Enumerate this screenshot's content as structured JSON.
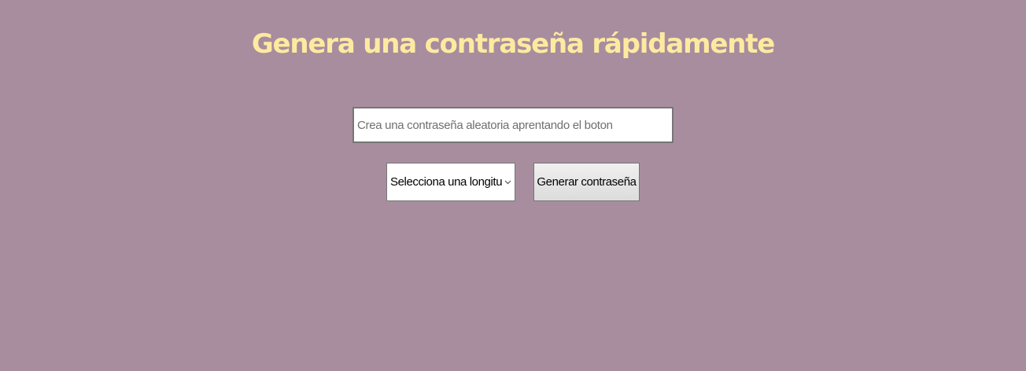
{
  "page": {
    "title": "Genera una contraseña rápidamente"
  },
  "password_input": {
    "value": "",
    "placeholder": "Crea una contraseña aleatoria aprentando el boton"
  },
  "length_select": {
    "selected_label": "Selecciona una longitud",
    "icon": "chevron-down-icon"
  },
  "generate_button": {
    "label": "Generar contraseña"
  },
  "colors": {
    "background": "#a88d9f",
    "title": "#fdeaa0"
  }
}
